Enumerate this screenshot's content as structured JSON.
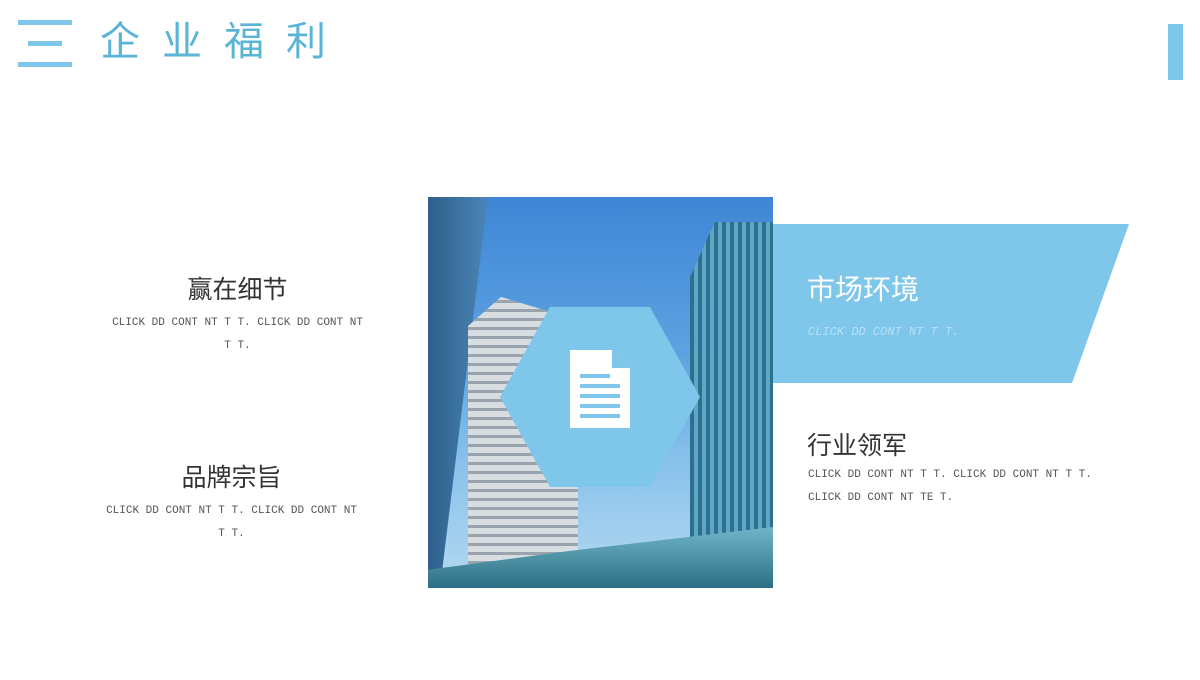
{
  "header": {
    "title": "企业福利",
    "menu_icon": "menu-icon"
  },
  "colors": {
    "accent": "#7ec6ea",
    "title": "#5ab4d6"
  },
  "center": {
    "icon": "document-icon"
  },
  "items": [
    {
      "title": "赢在细节",
      "body": "CLICK  DD CONT NT T  T. CLICK  DD CONT NT T  T."
    },
    {
      "title": "品牌宗旨",
      "body": "CLICK  DD CONT NT T  T. CLICK  DD CONT NT T  T."
    },
    {
      "title": "市场环境",
      "body": "CLICK  DD CONT NT T  T."
    },
    {
      "title": "行业领军",
      "body": "CLICK  DD CONT NT T  T. CLICK  DD CONT NT T  T. CLICK  DD CONT NT TE T."
    }
  ]
}
